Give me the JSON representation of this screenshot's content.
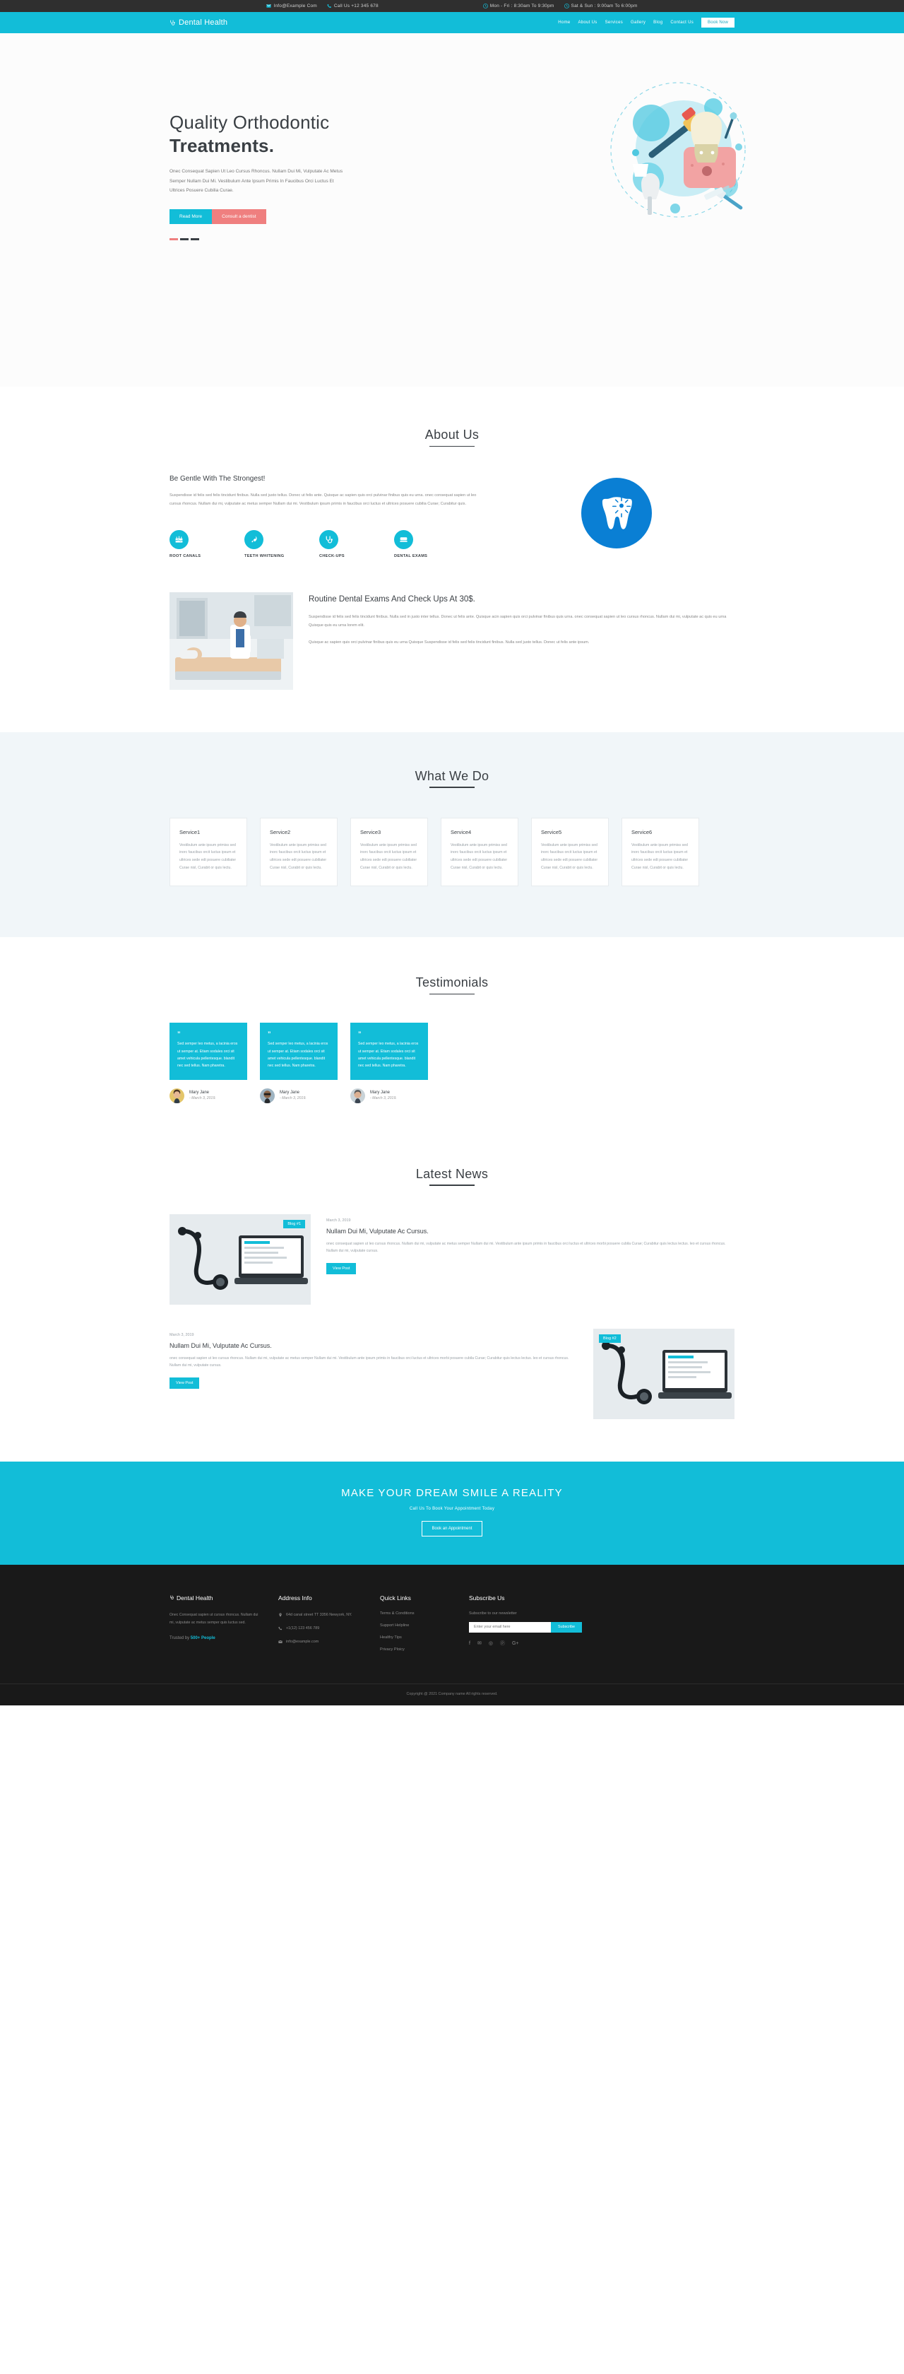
{
  "topbar": {
    "email": "Info@Example Com",
    "phone": "Call Us +12 345 678",
    "weekday_hours": "Mon - Fri : 8:30am To 9:30pm",
    "weekend_hours": "Sat & Sun : 9:00am To 6:00pm"
  },
  "nav": {
    "brand": "Dental Health",
    "links": [
      {
        "label": "Home"
      },
      {
        "label": "About Us"
      },
      {
        "label": "Services"
      },
      {
        "label": "Gallery"
      },
      {
        "label": "Blog"
      },
      {
        "label": "Contact Us"
      }
    ],
    "book_button": "Book Now"
  },
  "hero": {
    "title_line1": "Quality Orthodontic",
    "title_line2": "Treatments.",
    "paragraph": "Onec Consequat Sapien Ut Leo Cursus Rhoncus. Nullam Dui Mi, Vulputate Ac Metus Semper Nullam Dui Mi. Vestibulum Ante Ipsum Primis In Faucibus Orci Luctus Et Ultrices Posuere Cubilia Curae.",
    "btn_read_more": "Read More",
    "btn_consult": "Consult a dentist"
  },
  "about": {
    "section_title": "About Us",
    "heading": "Be Gentle With The Strongest!",
    "paragraph": "Suspendisse id felis sed felis tincidunt finibus. Nulla sed justo tellus. Donec ut felis ante. Quisque ac sapien quis orci pulvinar finibus quis eu urna. onec consequat sapien ut leo cursus rhoncus. Nullam dui mi, vulputate ac metus semper Nullam dui mi. Vestibulum ipsum primis in faucibus orci luctus et ultrices posuere cubilia Curae; Curabitur quis.",
    "features": [
      {
        "label": "ROOT CANALS",
        "icon": "tooth-canal-icon"
      },
      {
        "label": "TEETH WHITENING",
        "icon": "rocket-icon"
      },
      {
        "label": "CHECK-UPS",
        "icon": "stethoscope-icon"
      },
      {
        "label": "DENTAL EXAMS",
        "icon": "exam-chair-icon"
      }
    ]
  },
  "routine": {
    "heading": "Routine Dental Exams And Check Ups At 30$.",
    "paragraph1": "Suspendisse id felis sed felis tincidunt finibus. Nulla sed in justo inter tellus. Donec ut felis ante. Quisque acin sapien quis orci pulvinar finibus quis urna. onec consequat sapien ut leo cursus rhoncus. Nullam dui mi, vulputate ac quis eu urna Quisque quis eu urna lorem elit.",
    "paragraph2": "Quisque ac sapien quis orci pulvinar finibus quis eu urna Quisque Suspendisse id felis sed felis tincidunt finibus. Nulla sed justo tellus. Donec ut felis ante ipsum."
  },
  "what_we_do": {
    "section_title": "What We Do",
    "cards": [
      {
        "title": "Service1",
        "text": "Vestibulum ante ipsum primiss sed inorc faucibus orcit luctus ipsum et ultrices sede edt posuere cubiliater Curae nisl, Curabit or quis lectu."
      },
      {
        "title": "Service2",
        "text": "Vestibulum ante ipsum primiss sed inorc faucibus orcit luctus ipsum et ultrices sede edt posuere cubiliater Curae nisl, Curabit or quis lectu."
      },
      {
        "title": "Service3",
        "text": "Vestibulum ante ipsum primiss sed inorc faucibus orcit luctus ipsum et ultrices sede edt posuere cubiliater Curae nisl, Curabit or quis lectu."
      },
      {
        "title": "Service4",
        "text": "Vestibulum ante ipsum primiss sed inorc faucibus orcit luctus ipsum et ultrices sede edt posuere cubiliater Curae nisl, Curabit or quis lectu."
      },
      {
        "title": "Service5",
        "text": "Vestibulum ante ipsum primiss sed inorc faucibus orcit luctus ipsum et ultrices sede edt posuere cubiliater Curae nisl, Curabit or quis lectu."
      },
      {
        "title": "Service6",
        "text": "Vestibulum ante ipsum primiss sed inorc faucibus orcit luctus ipsum et ultrices sede edt posuere cubiliater Curae nisl, Curabit or quis lectu."
      }
    ]
  },
  "testimonials": {
    "section_title": "Testimonials",
    "items": [
      {
        "quote_mark": "”",
        "text": "Sed semper leo metus, a lacinia eros ut semper at. Etiam sodales orci sit amet vehicula pellentesque. blandit nec sed tellus. Nam pharetra.",
        "name": "Mary Jane",
        "date": "- March 3, 2019."
      },
      {
        "quote_mark": "”",
        "text": "Sed semper leo metus, a lacinia eros ut semper at. Etiam sodales orci sit amet vehicula pellentesque. blandit nec sed tellus. Nam pharetra.",
        "name": "Mary Jane",
        "date": "- March 3, 2019."
      },
      {
        "quote_mark": "”",
        "text": "Sed semper leo metus, a lacinia eros ut semper at. Etiam sodales orci sit amet vehicula pellentesque. blandit nec sed tellus. Nam pharetra.",
        "name": "Mary Jane",
        "date": "- March 3, 2019."
      }
    ]
  },
  "news": {
    "section_title": "Latest News",
    "posts": [
      {
        "badge": "Blog #1",
        "date": "March 3, 2019",
        "title": "Nullam Dui Mi, Vulputate Ac Cursus.",
        "text": "onec consequat sapien ut leo cursus rhoncus. Nullam dui mi, vulputate ac metus semper Nullam dui mi. Vestibulum ante ipsum primis in faucibus orci luctus et ultrices morbi posuere cubila Curae; Curabitur quis lectus lectus. leo et cursus rhoncus. Nullam dui mi, vulputate cursus.",
        "button": "View Post"
      },
      {
        "badge": "Blog #2",
        "date": "March 3, 2019",
        "title": "Nullam Dui Mi, Vulputate Ac Cursus.",
        "text": "onec consequat sapien ut leo cursus rhoncus. Nullam dui mi, vulputate ac metus semper Nullam dui mi. Vestibulum ante ipsum primis in faucibus orci luctus et ultrices morbi posuere cubila Curae; Curabitur quis lectus lectus. leo et cursus rhoncus. Nullam dui mi, vulputate cursus.",
        "button": "View Post"
      }
    ]
  },
  "cta": {
    "heading": "MAKE YOUR DREAM SMILE A REALITY",
    "subheading": "Call Us To Book Your Appointment Today",
    "button": "Book an Appointment"
  },
  "footer": {
    "brand": "Dental Health",
    "about_text": "Onec Consequat sapien ut cursus rhoncus. Nullam dui mi, vulputate ac metus semper quis luctus sed.",
    "trust_prefix": "Trusted by ",
    "trust_count": "500+ People",
    "address_title": "Address Info",
    "address_line": "64d canal street TT 3356 Newyork, NY.",
    "address_phone": "+1(12) 123 456 789",
    "address_email": "info@example.com",
    "quick_title": "Quick Links",
    "quick_links": [
      {
        "label": "Terms & Conditions"
      },
      {
        "label": "Support Helpline"
      },
      {
        "label": "Healthy Tips"
      },
      {
        "label": "Privacy Ploicy"
      }
    ],
    "subscribe_title": "Subscribe Us",
    "subscribe_text": "Subscribe to our newsletter",
    "email_placeholder": "Enter your email here",
    "subscribe_button": "Subscribe",
    "social": [
      {
        "icon": "facebook-icon",
        "glyph": "f"
      },
      {
        "icon": "twitter-icon",
        "glyph": "✉"
      },
      {
        "icon": "dribbble-icon",
        "glyph": "◎"
      },
      {
        "icon": "pinterest-icon",
        "glyph": "ⓟ"
      },
      {
        "icon": "google-plus-icon",
        "glyph": "G+"
      }
    ],
    "copyright": "Copyright @ 2021 Company name All rights reserved."
  },
  "colors": {
    "accent": "#12bdd8",
    "coral": "#ef7f7f",
    "dark": "#191919",
    "heading": "#3a3f44"
  }
}
